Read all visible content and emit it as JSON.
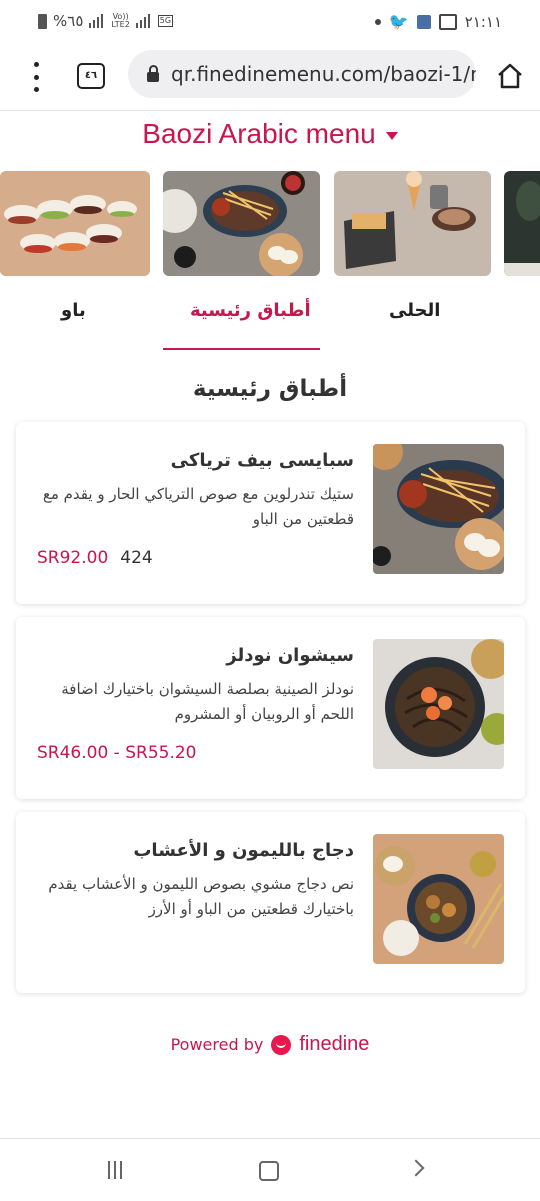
{
  "status_bar": {
    "battery": "%٦٥",
    "network_tag_top": "Vo))",
    "network_tag_bottom": "LTE2",
    "network_tag_5g": "5G",
    "time": "٢١:١١"
  },
  "browser": {
    "tab_count": "٤٦",
    "url": "qr.finedinemenu.com/baozi-1/n"
  },
  "menu": {
    "title": "Baozi Arabic menu"
  },
  "tabs": [
    {
      "label": "الحلى"
    },
    {
      "label": "أطباق رئيسية"
    },
    {
      "label": "باو"
    }
  ],
  "section_title": "أطباق رئيسية",
  "dishes": [
    {
      "name": "سبايسى بيف ترياكى",
      "description": "ستيك تندرلوين مع صوص الترياكي الحار و يقدم مع قطعتين من الباو",
      "price": "SR92.00",
      "calories": "424"
    },
    {
      "name": "سيشوان نودلز",
      "description": "نودلز الصينية بصلصة السيشوان باختيارك اضافة اللحم أو الروبيان أو المشروم",
      "price": "SR46.00 - SR55.20",
      "calories": ""
    },
    {
      "name": "دجاج بالليمون و الأعشاب",
      "description": "نص دجاج مشوي بصوص الليمون و الأعشاب يقدم باختيارك قطعتين من الباو أو الأرز",
      "price": "",
      "calories": ""
    }
  ],
  "footer": {
    "powered_by": "Powered by",
    "brand": "finedine"
  },
  "colors": {
    "accent": "#c8164f",
    "text": "#333333"
  },
  "icons": [
    "signal-icon",
    "home-icon",
    "lock-icon",
    "menu-kebab-icon",
    "tabs-icon",
    "caret-down-icon",
    "finedine-logo-icon",
    "nav-recents-icon",
    "nav-home-icon",
    "nav-back-icon"
  ]
}
